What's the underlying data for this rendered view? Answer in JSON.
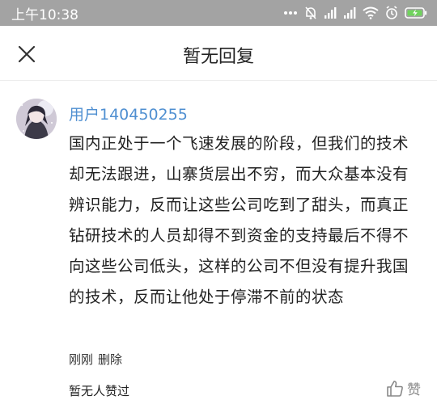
{
  "status_bar": {
    "time": "上午10:38",
    "icons": [
      "more-dots-icon",
      "mute-bell-icon",
      "signal-icon",
      "signal-icon",
      "wifi-icon",
      "alarm-icon",
      "battery-charging-icon"
    ]
  },
  "header": {
    "title": "暂无回复",
    "close_icon": "close-icon"
  },
  "comment": {
    "username": "用户140450255",
    "text": "国内正处于一个飞速发展的阶段，但我们的技术却无法跟进，山寨货层出不穷，而大众基本没有辨识能力，反而让这些公司吃到了甜头，而真正钻研技术的人员却得不到资金的支持最后不得不向这些公司低头，这样的公司不但没有提升我国的技术，反而让他处于停滞不前的状态",
    "time": "刚刚",
    "delete_label": "删除"
  },
  "footer": {
    "likes_text": "暂无人赞过",
    "like_label": "赞"
  },
  "colors": {
    "status_bar_bg": "#a3a3a3",
    "username": "#4f8fd1",
    "battery_accent": "#6fd35c"
  }
}
